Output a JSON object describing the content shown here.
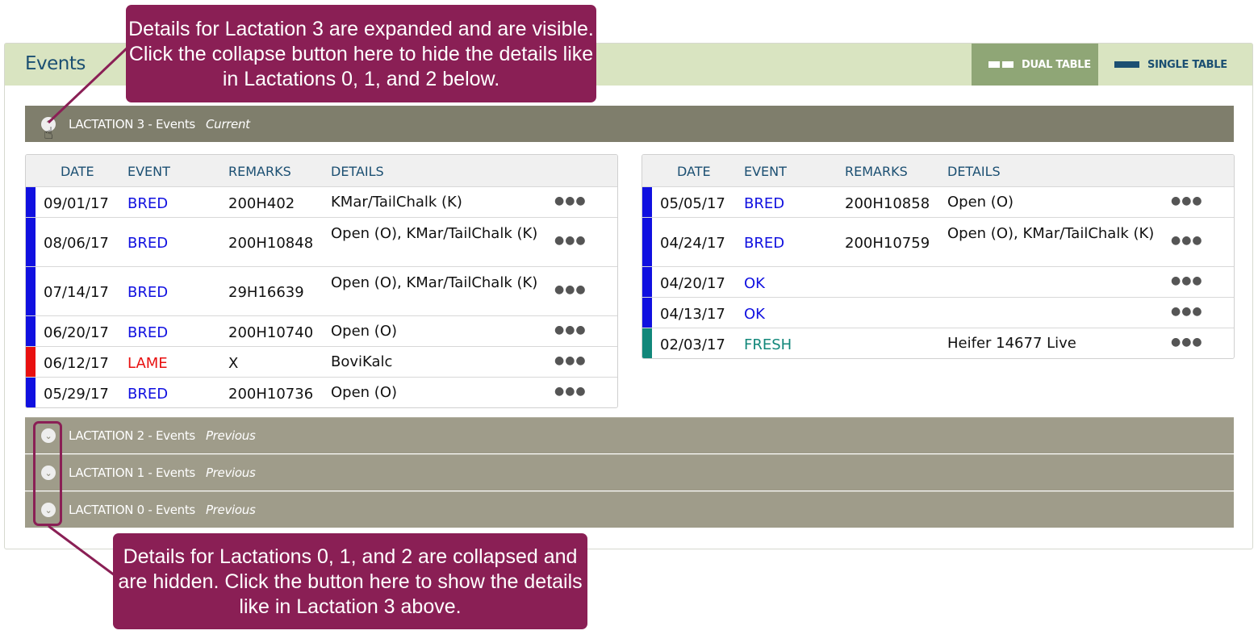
{
  "panel": {
    "title": "Events",
    "view_dual_label": "DUAL TABLE",
    "view_single_label": "SINGLE TABLE"
  },
  "lactations": [
    {
      "name": "LACTATION 3 - Events",
      "status": "Current"
    },
    {
      "name": "LACTATION 2 - Events",
      "status": "Previous"
    },
    {
      "name": "LACTATION 1 - Events",
      "status": "Previous"
    },
    {
      "name": "LACTATION 0 - Events",
      "status": "Previous"
    }
  ],
  "table": {
    "headers": {
      "date": "DATE",
      "event": "EVENT",
      "remarks": "REMARKS",
      "details": "DETAILS"
    },
    "more": "●●●",
    "left_rows": [
      {
        "date": "09/01/17",
        "event": "BRED",
        "remarks": "200H402",
        "details": "KMar/TailChalk (K)"
      },
      {
        "date": "08/06/17",
        "event": "BRED",
        "remarks": "200H10848",
        "details": "Open (O), KMar/TailChalk (K)"
      },
      {
        "date": "07/14/17",
        "event": "BRED",
        "remarks": "29H16639",
        "details": "Open (O), KMar/TailChalk (K)"
      },
      {
        "date": "06/20/17",
        "event": "BRED",
        "remarks": "200H10740",
        "details": "Open (O)"
      },
      {
        "date": "06/12/17",
        "event": "LAME",
        "remarks": "X",
        "details": "BoviKalc"
      },
      {
        "date": "05/29/17",
        "event": "BRED",
        "remarks": "200H10736",
        "details": "Open (O)"
      }
    ],
    "right_rows": [
      {
        "date": "05/05/17",
        "event": "BRED",
        "remarks": "200H10858",
        "details": "Open (O)"
      },
      {
        "date": "04/24/17",
        "event": "BRED",
        "remarks": "200H10759",
        "details": "Open (O), KMar/TailChalk (K)"
      },
      {
        "date": "04/20/17",
        "event": "OK",
        "remarks": "",
        "details": ""
      },
      {
        "date": "04/13/17",
        "event": "OK",
        "remarks": "",
        "details": ""
      },
      {
        "date": "02/03/17",
        "event": "FRESH",
        "remarks": "",
        "details": "Heifer 14677 Live"
      }
    ]
  },
  "event_colors": {
    "BRED": "#1010e0",
    "LAME": "#e81010",
    "OK": "#1010e0",
    "FRESH": "#12877a"
  },
  "callouts": {
    "top": "Details for Lactation 3 are expanded and are visible. Click the collapse button here to hide the details like in Lactations 0, 1, and 2 below.",
    "bottom": "Details for Lactations 0, 1, and 2 are collapsed and are hidden. Click the button here to show the details like in Lactation 3 above."
  }
}
